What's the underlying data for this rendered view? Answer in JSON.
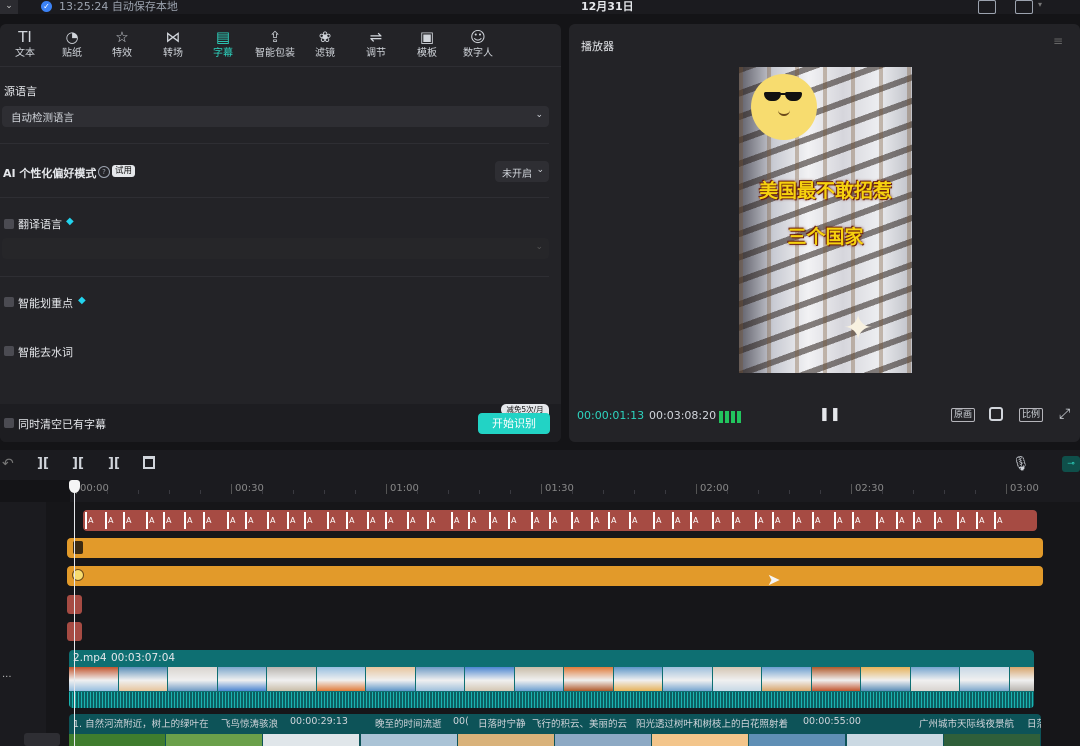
{
  "topbar": {
    "autosave_text": "13:25:24 自动保存本地",
    "project_title": "12月31日"
  },
  "tabs": [
    {
      "label": "文本",
      "icon": "TI",
      "name": "tab-text"
    },
    {
      "label": "贴纸",
      "icon": "◔",
      "name": "tab-sticker"
    },
    {
      "label": "特效",
      "icon": "☆",
      "name": "tab-effects"
    },
    {
      "label": "转场",
      "icon": "⋈",
      "name": "tab-transition"
    },
    {
      "label": "字幕",
      "icon": "▤",
      "name": "tab-subtitle"
    },
    {
      "label": "智能包装",
      "icon": "⇪",
      "name": "tab-smart-package"
    },
    {
      "label": "滤镜",
      "icon": "❀",
      "name": "tab-filter"
    },
    {
      "label": "调节",
      "icon": "⇌",
      "name": "tab-adjust"
    },
    {
      "label": "模板",
      "icon": "▣",
      "name": "tab-template"
    },
    {
      "label": "数字人",
      "icon": "☺",
      "name": "tab-digital-human"
    }
  ],
  "active_tab": "字幕",
  "subtitle_panel": {
    "source_language_label": "源语言",
    "source_language_value": "自动检测语言",
    "ai_mode_label": "AI 个性化偏好模式",
    "trial_badge": "试用",
    "ai_mode_value": "未开启",
    "translate_label": "翻译语言",
    "highlight_label": "智能划重点",
    "remove_filler_label": "智能去水词",
    "clear_existing_label": "同时清空已有字幕",
    "free_quota_badge": "减免5次/月",
    "start_button": "开始识别"
  },
  "player": {
    "title": "播放器",
    "video_caption_line1": "美国最不敢招惹",
    "video_caption_line2": "三个国家",
    "current_time": "00:00:01:13",
    "total_time": "00:03:08:20",
    "btn_original": "原画",
    "btn_ratio": "比例"
  },
  "timeline": {
    "ruler_ticks": [
      "00:00",
      "00:30",
      "01:00",
      "01:30",
      "02:00",
      "02:30",
      "03:00"
    ],
    "clip1_name": "2.mp4",
    "clip1_duration": "00:03:07:04",
    "audio_text_1": "1. 自然河流附近，树上的绿叶在",
    "audio_text_2": "飞鸟惊涛骇浪",
    "audio_text_3": "00:00:29:13",
    "audio_text_4": "晚至的时间流逝",
    "audio_text_5": "00(",
    "audio_text_6": "日落时宁静",
    "audio_text_7": "飞行的积云、美丽的云",
    "audio_text_8": "阳光透过树叶和树枝上的白花照射着",
    "audio_text_9": "00:00:55:00",
    "audio_text_10": "广州城市天际线夜景航",
    "audio_text_11": "日落"
  },
  "colors": {
    "accent": "#2dd4bf",
    "track_orange": "#e29a2a",
    "caption_yellow": "#f6d20f",
    "subtitle_clip_red": "#a64b43"
  }
}
